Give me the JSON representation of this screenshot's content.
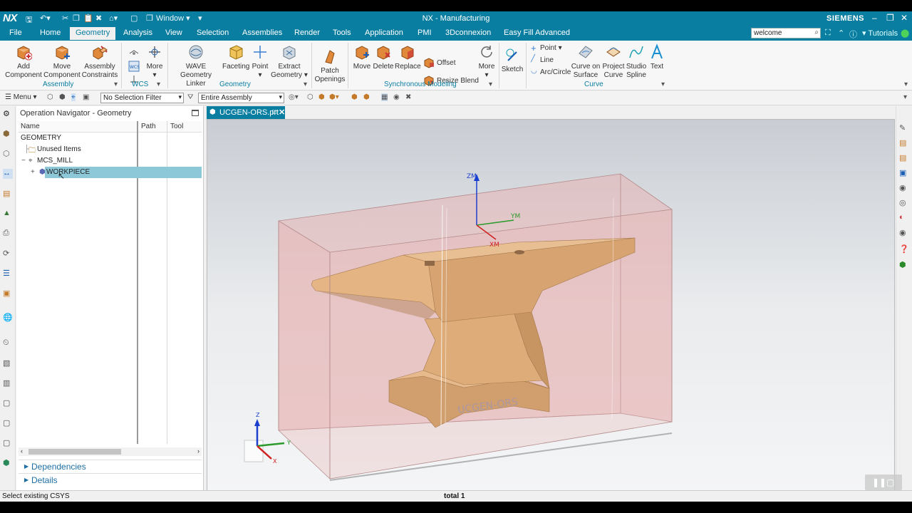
{
  "app": {
    "logo": "NX",
    "title": "NX - Manufacturing",
    "brand": "SIEMENS",
    "window_menu": "Window"
  },
  "menu_tabs": [
    "File",
    "Home",
    "Geometry",
    "Analysis",
    "View",
    "Selection",
    "Assemblies",
    "Render",
    "Tools",
    "Application",
    "PMI",
    "3Dconnexion",
    "Easy Fill Advanced"
  ],
  "active_tab": "Geometry",
  "search": {
    "value": "welcome"
  },
  "tutorials_label": "Tutorials",
  "ribbon": {
    "assembly": {
      "add_component": [
        "Add",
        "Component"
      ],
      "move_component": [
        "Move",
        "Component"
      ],
      "assembly_constraints": [
        "Assembly",
        "Constraints"
      ],
      "group": "Assembly"
    },
    "wcs": {
      "more": "More",
      "group": "WCS"
    },
    "geometry": {
      "wave_geometry_linker": [
        "WAVE Geometry",
        "Linker"
      ],
      "faceting": "Faceting",
      "point": "Point",
      "extract_geometry": [
        "Extract",
        "Geometry"
      ],
      "group": "Geometry"
    },
    "sync": {
      "patch_openings": [
        "Patch",
        "Openings"
      ],
      "move": "Move",
      "delete": "Delete",
      "replace": "Replace",
      "offset": "Offset",
      "resize_blend": "Resize Blend",
      "more": "More",
      "group": "Synchronous Modeling"
    },
    "sketch": "Sketch",
    "curve": {
      "point": "Point",
      "line": "Line",
      "arc_circle": "Arc/Circle",
      "curve_on_surface": [
        "Curve on",
        "Surface"
      ],
      "project_curve": [
        "Project",
        "Curve"
      ],
      "studio_spline": [
        "Studio",
        "Spline"
      ],
      "text": "Text",
      "group": "Curve"
    }
  },
  "toolbar2": {
    "menu": "Menu",
    "selection_filter": "No Selection Filter",
    "assembly_scope": "Entire Assembly"
  },
  "navigator": {
    "title": "Operation Navigator - Geometry",
    "columns": [
      "Name",
      "Path",
      "Tool"
    ],
    "rows": [
      {
        "label": "GEOMETRY"
      },
      {
        "label": "Unused Items"
      },
      {
        "label": "MCS_MILL"
      },
      {
        "label": "WORKPIECE"
      }
    ],
    "sections": [
      "Dependencies",
      "Details"
    ]
  },
  "file_tab": "UCGEN-ORS.prt",
  "viewport": {
    "axis_labels": {
      "zm": "ZM",
      "ym": "YM",
      "xm": "XM",
      "z": "Z",
      "y": "Y",
      "x": "X"
    },
    "engraving": "UCGEN-ORS"
  },
  "status": {
    "prompt": "Select existing CSYS",
    "count": "total 1"
  },
  "colors": {
    "accent": "#0a7ea1",
    "selection": "#8cc8d8",
    "part": "#d9a55c",
    "blank_box": "#e8b4b4"
  }
}
